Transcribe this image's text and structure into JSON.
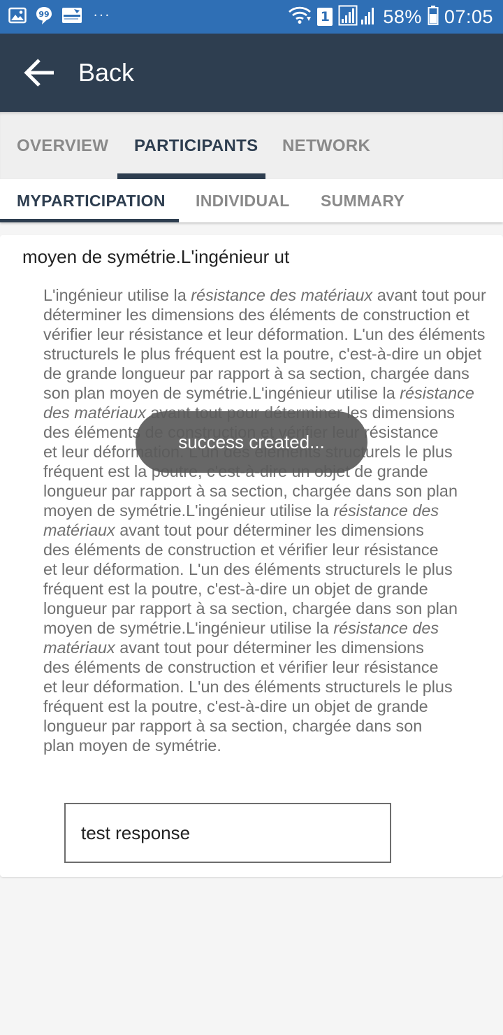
{
  "status_bar": {
    "battery_percent": "58%",
    "time": "07:05",
    "more_dots": "···",
    "sim_label": "1",
    "icons": [
      "gallery-icon",
      "chat-icon",
      "app-notification-icon",
      "wifi-icon",
      "sim-icon",
      "signal-icon",
      "battery-icon"
    ]
  },
  "app_bar": {
    "back_label": "Back",
    "icon": "arrow-left-icon"
  },
  "main_tabs": [
    {
      "label": "OVERVIEW",
      "active": false
    },
    {
      "label": "PARTICIPANTS",
      "active": true
    },
    {
      "label": "NETWORK",
      "active": false
    }
  ],
  "sub_tabs": [
    {
      "label": "MYPARTICIPATION",
      "active": true
    },
    {
      "label": "INDIVIDUAL",
      "active": false
    },
    {
      "label": "SUMMARY",
      "active": false
    }
  ],
  "question": {
    "title": "moyen de symétrie.L'ingénieur ut",
    "lines": [
      [
        "L'ingénieur utilise la ",
        {
          "i": "résistance des matériaux"
        },
        " avant tout pour"
      ],
      [
        "déterminer les dimensions des éléments de construction et"
      ],
      [
        "vérifier leur résistance et leur déformation. L'un des éléments"
      ],
      [
        "structurels le plus fréquent est la poutre, c'est-à-dire un objet"
      ],
      [
        "de grande longueur par rapport à sa section, chargée dans"
      ],
      [
        "son plan moyen de symétrie.L'ingénieur utilise la ",
        {
          "i": "résistance"
        }
      ],
      [
        {
          "i": "des matériaux"
        },
        " avant tout pour déterminer les dimensions"
      ],
      [
        "des éléments de construction et vérifier leur résistance"
      ],
      [
        "et leur déformation. L'un des éléments structurels le plus"
      ],
      [
        "fréquent est la poutre, c'est-à-dire un objet de grande"
      ],
      [
        "longueur par rapport à sa section, chargée dans son plan"
      ],
      [
        "moyen de symétrie.L'ingénieur utilise la ",
        {
          "i": "résistance des"
        }
      ],
      [
        {
          "i": "matériaux"
        },
        " avant tout pour déterminer les dimensions"
      ],
      [
        "des éléments de construction et vérifier leur résistance"
      ],
      [
        "et leur déformation. L'un des éléments structurels le plus"
      ],
      [
        "fréquent est la poutre, c'est-à-dire un objet de grande"
      ],
      [
        "longueur par rapport à sa section, chargée dans son plan"
      ],
      [
        "moyen de symétrie.L'ingénieur utilise la ",
        {
          "i": "résistance des"
        }
      ],
      [
        {
          "i": "matériaux"
        },
        " avant tout pour déterminer les dimensions"
      ],
      [
        "des éléments de construction et vérifier leur résistance"
      ],
      [
        "et leur déformation. L'un des éléments structurels le plus"
      ],
      [
        "fréquent est la poutre, c'est-à-dire un objet de grande"
      ],
      [
        "longueur par rapport à sa section, chargée dans son"
      ],
      [
        "plan moyen de symétrie."
      ]
    ]
  },
  "response": {
    "value": "test response"
  },
  "toast": {
    "message": "success created..."
  },
  "colors": {
    "status_bar": "#2f6fb5",
    "app_bar": "#2e3e50",
    "active_tab": "#2e3e50",
    "inactive_tab": "#8a8a8a"
  }
}
